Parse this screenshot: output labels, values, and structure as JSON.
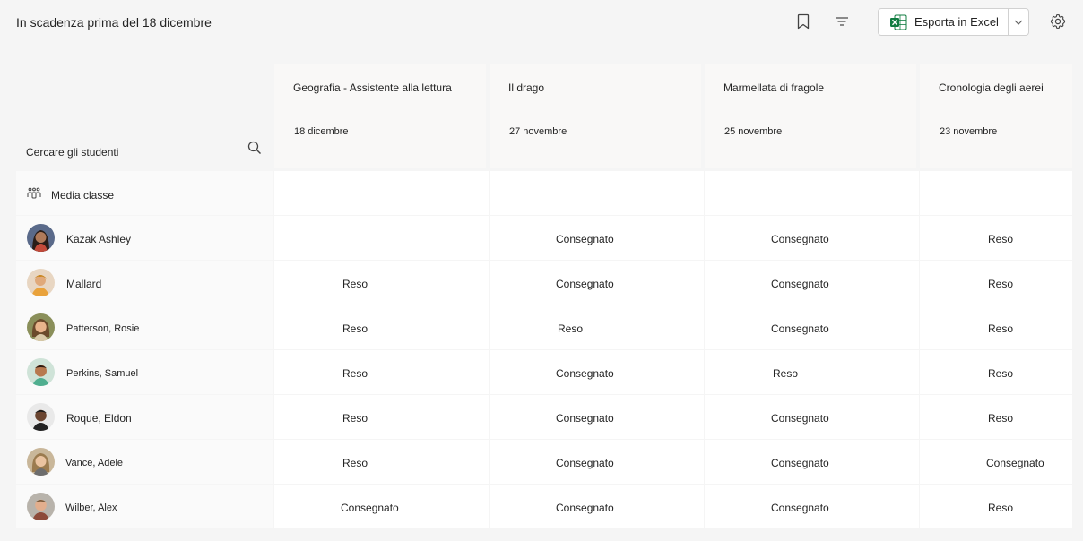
{
  "header": {
    "title": "In scadenza prima del 18 dicembre",
    "export_label": "Esporta in Excel"
  },
  "search": {
    "placeholder": "Cercare gli studenti"
  },
  "class_average_label": "Media classe",
  "assignments": [
    {
      "title": "Geografia - Assistente alla lettura",
      "due": "18 dicembre"
    },
    {
      "title": "Il drago",
      "due": "27 novembre"
    },
    {
      "title": "Marmellata di fragole",
      "due": "25 novembre"
    },
    {
      "title": "Cronologia degli aerei",
      "due": "23 novembre"
    }
  ],
  "students": [
    {
      "name": "Kazak Ashley",
      "statuses": [
        "",
        "Consegnato",
        "Consegnato",
        "Reso"
      ]
    },
    {
      "name": "Mallard",
      "statuses": [
        "Reso",
        "Consegnato",
        "Consegnato",
        "Reso"
      ]
    },
    {
      "name": "Patterson, Rosie",
      "statuses": [
        "Reso",
        "Reso",
        "Consegnato",
        "Reso"
      ]
    },
    {
      "name": "Perkins, Samuel",
      "statuses": [
        "Reso",
        "Consegnato",
        "Reso",
        "Reso"
      ]
    },
    {
      "name": "Roque, Eldon",
      "statuses": [
        "Reso",
        "Consegnato",
        "Consegnato",
        "Reso"
      ]
    },
    {
      "name": "Vance, Adele",
      "statuses": [
        "Reso",
        "Consegnato",
        "Consegnato",
        "Consegnato"
      ]
    },
    {
      "name": "Wilber, Alex",
      "statuses": [
        "Consegnato",
        "Consegnato",
        "Consegnato",
        "Reso"
      ]
    }
  ],
  "icons": {
    "bookmark": "bookmark-icon",
    "filter": "filter-icon",
    "excel": "excel-icon",
    "chevron": "chevron-down-icon",
    "settings": "gear-icon",
    "search": "search-icon",
    "class_average": "people-group-icon"
  },
  "colors": {
    "excel_green": "#107c41",
    "background": "#f5f5f5"
  }
}
